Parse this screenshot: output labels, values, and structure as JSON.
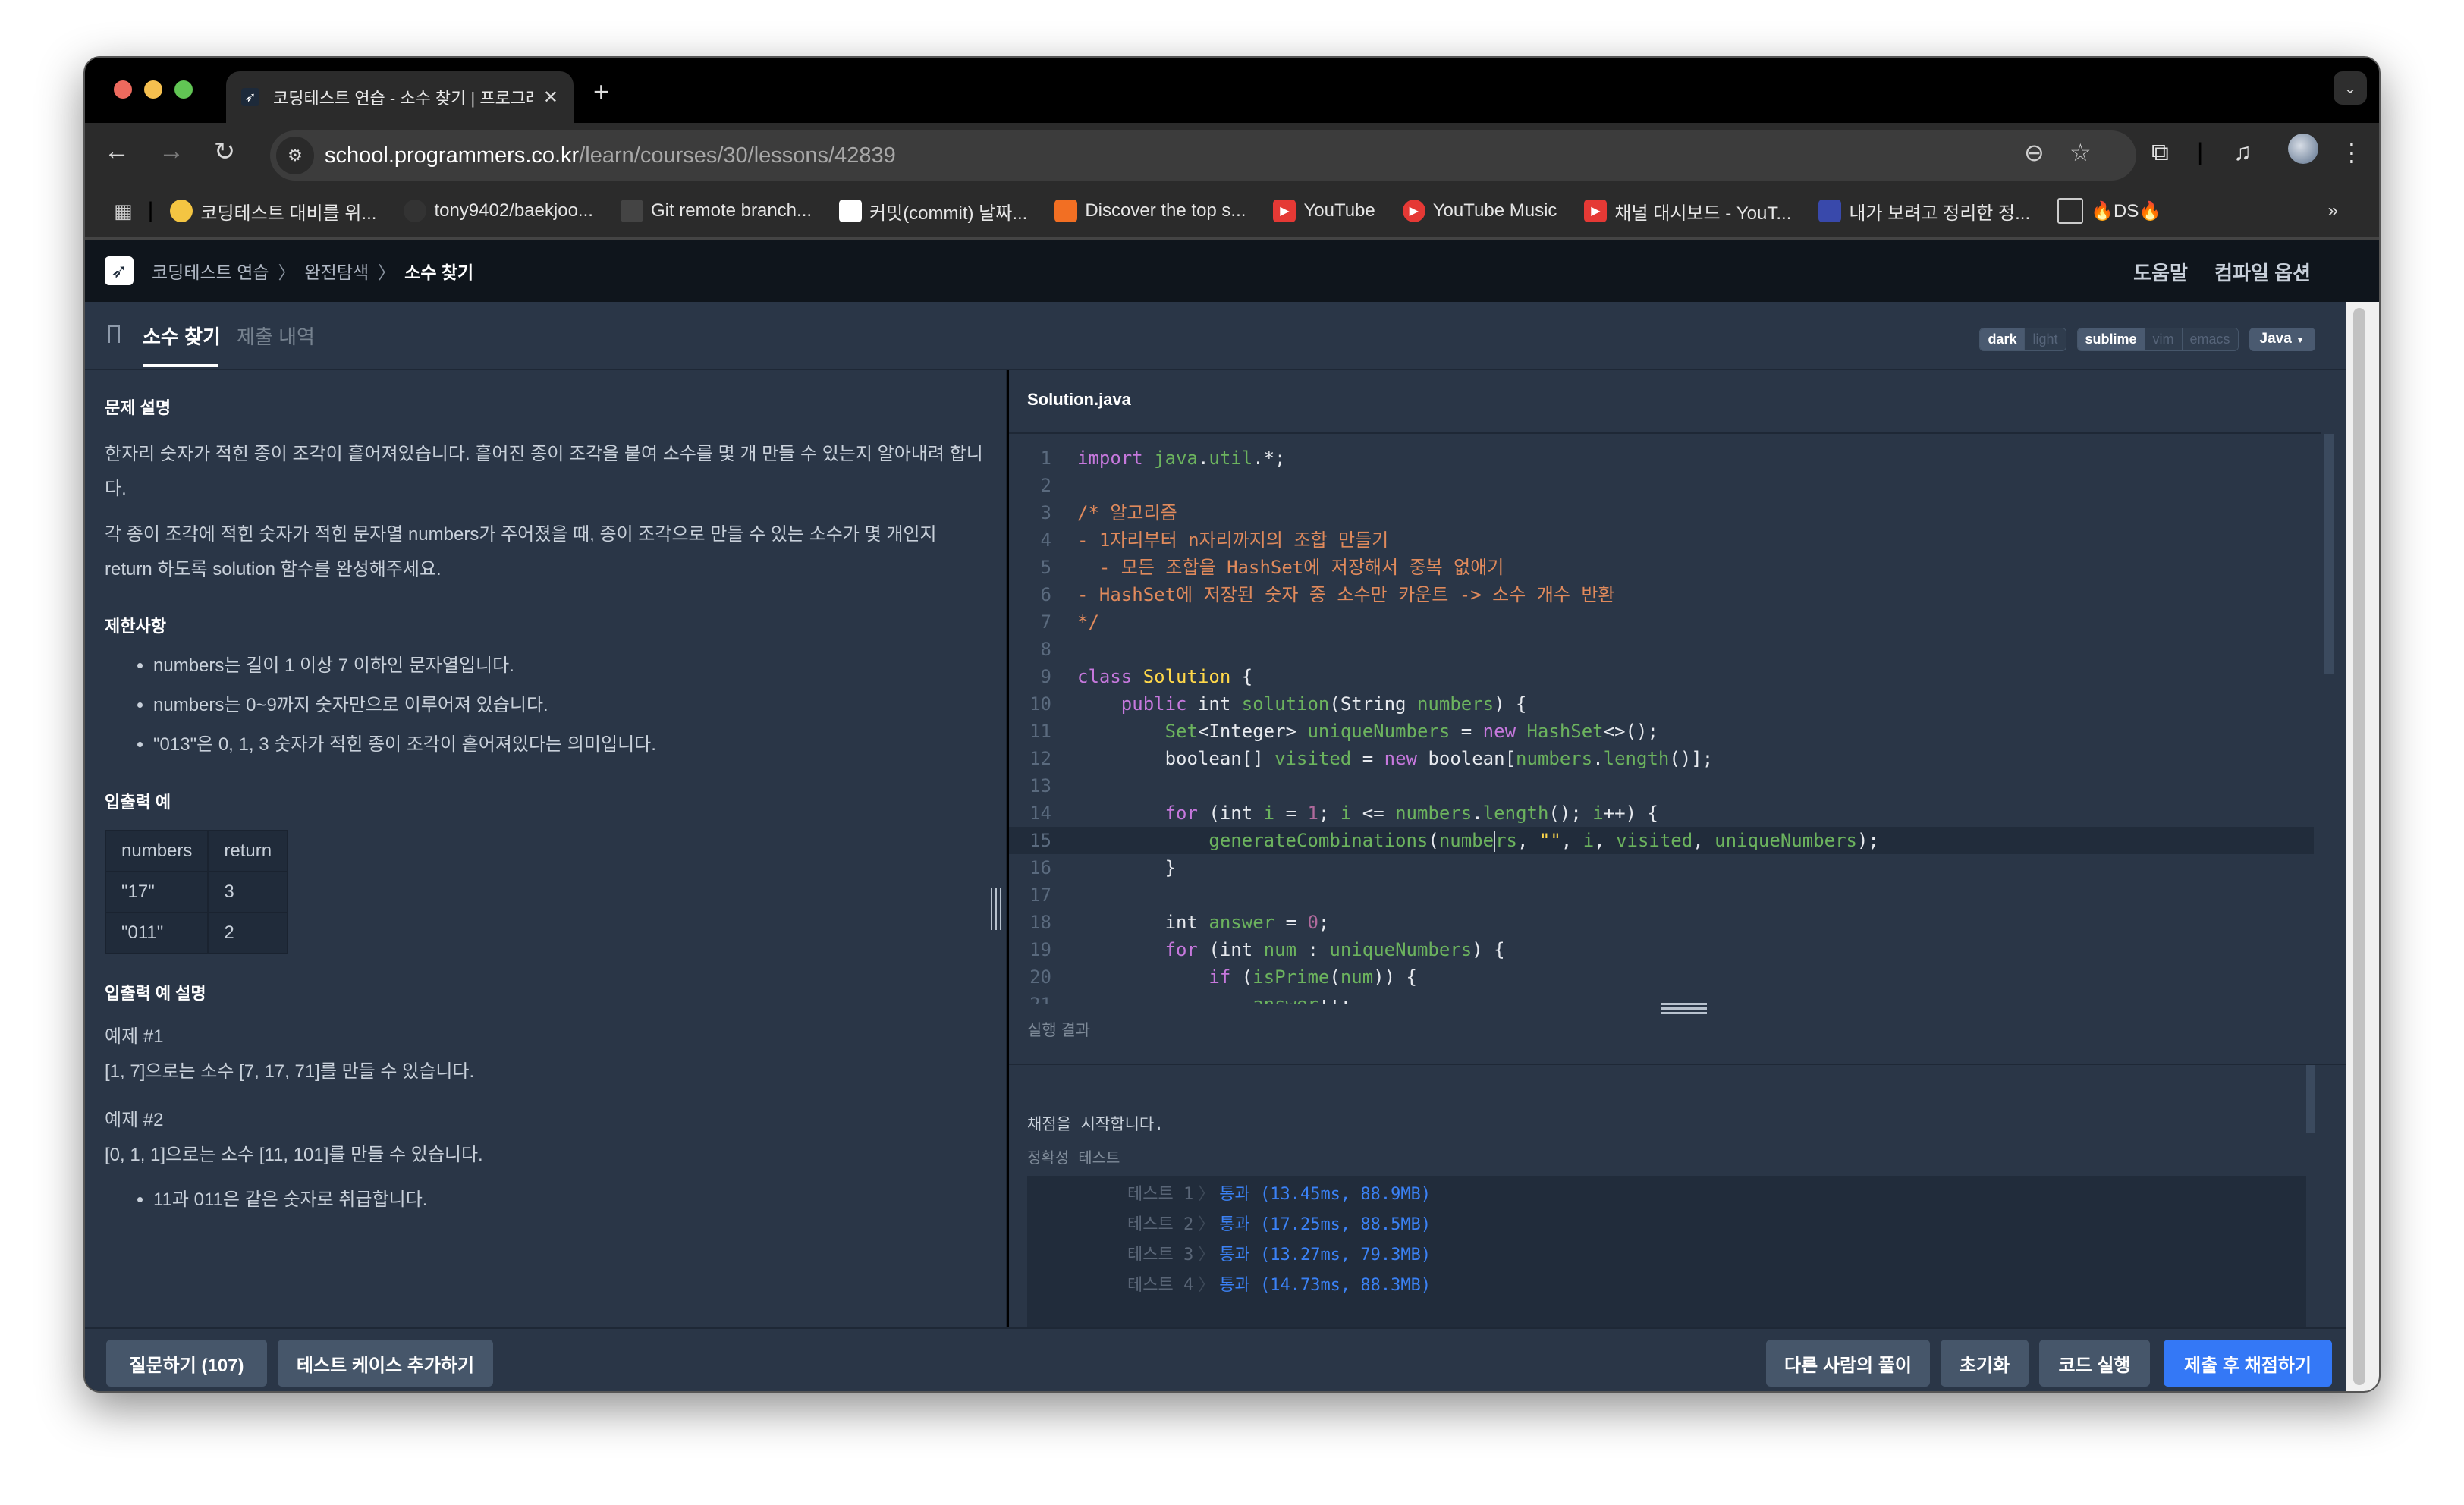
{
  "browser": {
    "tab_title": "코딩테스트 연습 - 소수 찾기 | 프로그래머스 스쿨",
    "new_tab_label": "+",
    "url_host": "school.programmers.co.kr",
    "url_path": "/learn/courses/30/lessons/42839",
    "bookmarks": [
      {
        "label": "코딩테스트 대비를 위...",
        "icon": "moon-icon",
        "color": "#f4c542"
      },
      {
        "label": "tony9402/baekjoo...",
        "icon": "github-icon",
        "color": "#333333"
      },
      {
        "label": "Git remote branch...",
        "icon": "penguin-icon",
        "color": "#444444"
      },
      {
        "label": "커밋(commit) 날짜...",
        "icon": "lobster-icon",
        "color": "#ffffff"
      },
      {
        "label": "Discover the top s...",
        "icon": "soundcloud-icon",
        "color": "#f26f23"
      },
      {
        "label": "YouTube",
        "icon": "youtube-icon",
        "color": "#e53935"
      },
      {
        "label": "YouTube Music",
        "icon": "youtube-music-icon",
        "color": "#e53935"
      },
      {
        "label": "채널 대시보드 - YouT...",
        "icon": "youtube-icon",
        "color": "#e53935"
      },
      {
        "label": "내가 보려고 정리한 정...",
        "icon": "notebook-icon",
        "color": "#3949ab"
      },
      {
        "label": "🔥DS🔥",
        "icon": "folder-icon",
        "color": "#cccccc"
      }
    ],
    "more_bookmarks": "»"
  },
  "app": {
    "breadcrumb": [
      "코딩테스트 연습",
      "완전탐색",
      "소수 찾기"
    ],
    "help": "도움말",
    "compile_options": "컴파일 옵션",
    "tabs": [
      {
        "label": "소수 찾기",
        "active": true
      },
      {
        "label": "제출 내역",
        "active": false
      }
    ],
    "theme_options": [
      {
        "label": "dark",
        "on": true
      },
      {
        "label": "light",
        "on": false
      }
    ],
    "keymap_options": [
      {
        "label": "sublime",
        "on": true
      },
      {
        "label": "vim",
        "on": false
      },
      {
        "label": "emacs",
        "on": false
      }
    ],
    "language": "Java"
  },
  "problem": {
    "desc_title": "문제 설명",
    "desc_p1": "한자리 숫자가 적힌 종이 조각이 흩어져있습니다. 흩어진 종이 조각을 붙여 소수를 몇 개 만들 수 있는지 알아내려 합니다.",
    "desc_p2": "각 종이 조각에 적힌 숫자가 적힌 문자열 numbers가 주어졌을 때, 종이 조각으로 만들 수 있는 소수가 몇 개인지 return 하도록 solution 함수를 완성해주세요.",
    "constraints_title": "제한사항",
    "constraints": [
      "numbers는 길이 1 이상 7 이하인 문자열입니다.",
      "numbers는 0~9까지 숫자만으로 이루어져 있습니다.",
      "\"013\"은 0, 1, 3 숫자가 적힌 종이 조각이 흩어져있다는 의미입니다."
    ],
    "io_title": "입출력 예",
    "io_table": {
      "headers": [
        "numbers",
        "return"
      ],
      "rows": [
        [
          "\"17\"",
          "3"
        ],
        [
          "\"011\"",
          "2"
        ]
      ]
    },
    "io_desc_title": "입출력 예 설명",
    "ex1_title": "예제 #1",
    "ex1_text": "[1, 7]으로는 소수 [7, 17, 71]를 만들 수 있습니다.",
    "ex2_title": "예제 #2",
    "ex2_text": "[0, 1, 1]으로는 소수 [11, 101]를 만들 수 있습니다.",
    "ex2_bullets": [
      "11과 011은 같은 숫자로 취급합니다."
    ]
  },
  "editor": {
    "filename": "Solution.java",
    "active_line": 15,
    "lines": [
      "import java.util.*;",
      "",
      "/* 알고리즘",
      "- 1자리부터 n자리까지의 조합 만들기",
      "  - 모든 조합을 HashSet에 저장해서 중복 없애기",
      "- HashSet에 저장된 숫자 중 소수만 카운트 -> 소수 개수 반환",
      "*/",
      "",
      "class Solution {",
      "    public int solution(String numbers) {",
      "        Set<Integer> uniqueNumbers = new HashSet<>();",
      "        boolean[] visited = new boolean[numbers.length()];",
      "",
      "        for (int i = 1; i <= numbers.length(); i++) {",
      "            generateCombinations(numbers, \"\", i, visited, uniqueNumbers);",
      "        }",
      "",
      "        int answer = 0;",
      "        for (int num : uniqueNumbers) {",
      "            if (isPrime(num)) {",
      "                answer++;"
    ]
  },
  "result": {
    "label": "실행 결과",
    "start_msg": "채점을 시작합니다.",
    "category": "정확성  테스트",
    "tests": [
      {
        "name": "테스트 1",
        "status": "통과",
        "detail": "(13.45ms, 88.9MB)"
      },
      {
        "name": "테스트 2",
        "status": "통과",
        "detail": "(17.25ms, 88.5MB)"
      },
      {
        "name": "테스트 3",
        "status": "통과",
        "detail": "(13.27ms, 79.3MB)"
      },
      {
        "name": "테스트 4",
        "status": "통과",
        "detail": "(14.73ms, 88.3MB)"
      }
    ]
  },
  "footer": {
    "ask": "질문하기 (107)",
    "add_testcase": "테스트 케이스 추가하기",
    "others_solution": "다른 사람의 풀이",
    "reset": "초기화",
    "run": "코드 실행",
    "submit": "제출 후 채점하기"
  },
  "colors": {
    "primary": "#3478f6",
    "pass": "#3b82f6",
    "panel_bg": "#2a3647"
  }
}
